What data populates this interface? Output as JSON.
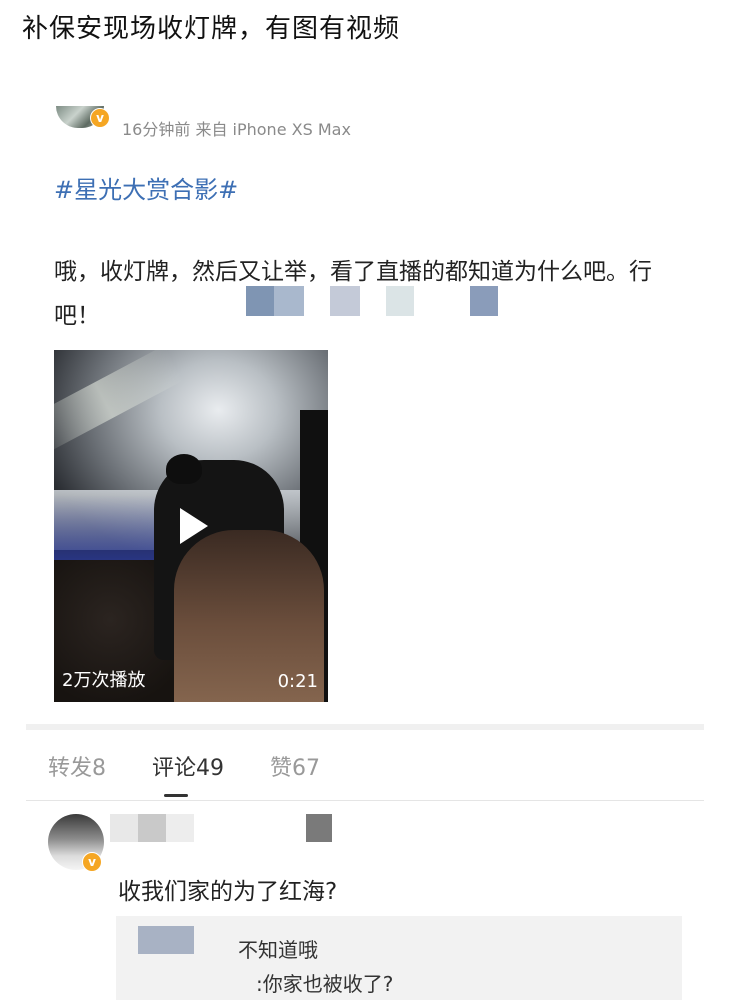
{
  "headline": "补保安现场收灯牌，有图有视频",
  "post": {
    "meta": "16分钟前 来自 iPhone XS Max",
    "verified_badge": "v",
    "topic": "#星光大赏合影#",
    "body": "哦，收灯牌，然后又让举，看了直播的都知道为什么吧。行吧！"
  },
  "video": {
    "views": "2万次播放",
    "duration": "0:21"
  },
  "tabs": [
    {
      "label": "转发8",
      "active": false
    },
    {
      "label": "评论49",
      "active": true
    },
    {
      "label": "赞67",
      "active": false
    }
  ],
  "comment": {
    "text": "收我们家的为了红海?",
    "badge": "v",
    "reply_lines": [
      "不知道哦",
      ":你家也被收了?"
    ]
  },
  "colors": {
    "topic": "#3d6fb4",
    "badge": "#f5a623",
    "muted": "#999999"
  }
}
